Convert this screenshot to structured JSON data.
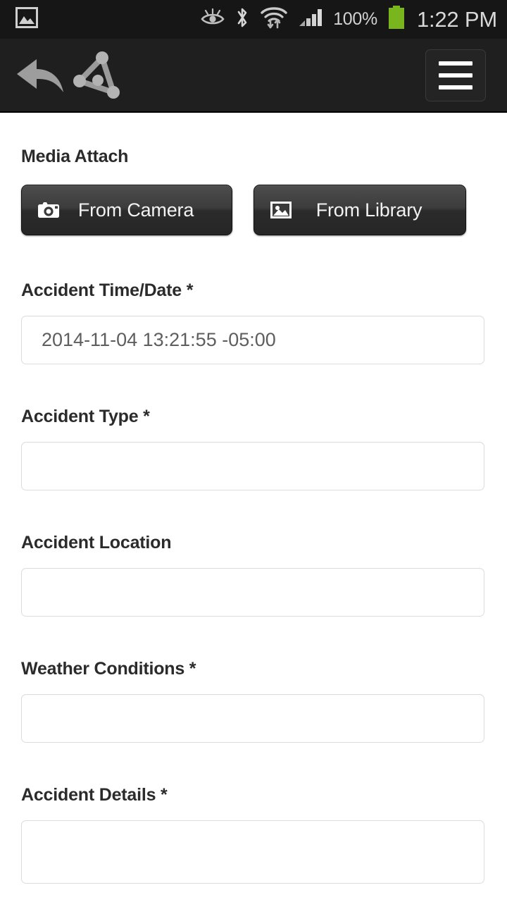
{
  "status_bar": {
    "notification_icon": "gallery-image-icon",
    "icons": [
      "smart-stay-eye-icon",
      "bluetooth-icon",
      "wifi-data-transfer-icon",
      "cellular-signal-icon"
    ],
    "battery_percent": "100%",
    "battery_color": "#79b51c",
    "time": "1:22 PM",
    "background_color": "#161616"
  },
  "nav_bar": {
    "back_icon": "back-arrow-icon",
    "logo_icon": "triangle-network-logo-icon",
    "menu_icon": "hamburger-menu-icon",
    "background_color": "#1f1f1f"
  },
  "form": {
    "media_attach": {
      "label": "Media Attach",
      "camera_button": {
        "label": "From Camera",
        "icon": "camera-icon"
      },
      "library_button": {
        "label": "From Library",
        "icon": "photo-library-icon"
      }
    },
    "fields": [
      {
        "name": "accident-time-date",
        "label": "Accident Time/Date *",
        "value": "2014-11-04 13:21:55 -05:00",
        "placeholder": "",
        "type": "input"
      },
      {
        "name": "accident-type",
        "label": "Accident Type *",
        "value": "",
        "placeholder": "",
        "type": "input"
      },
      {
        "name": "accident-location",
        "label": "Accident Location",
        "value": "",
        "placeholder": "",
        "type": "input"
      },
      {
        "name": "weather-conditions",
        "label": "Weather Conditions *",
        "value": "",
        "placeholder": "",
        "type": "input"
      },
      {
        "name": "accident-details",
        "label": "Accident Details *",
        "value": "",
        "placeholder": "",
        "type": "textarea"
      }
    ]
  }
}
